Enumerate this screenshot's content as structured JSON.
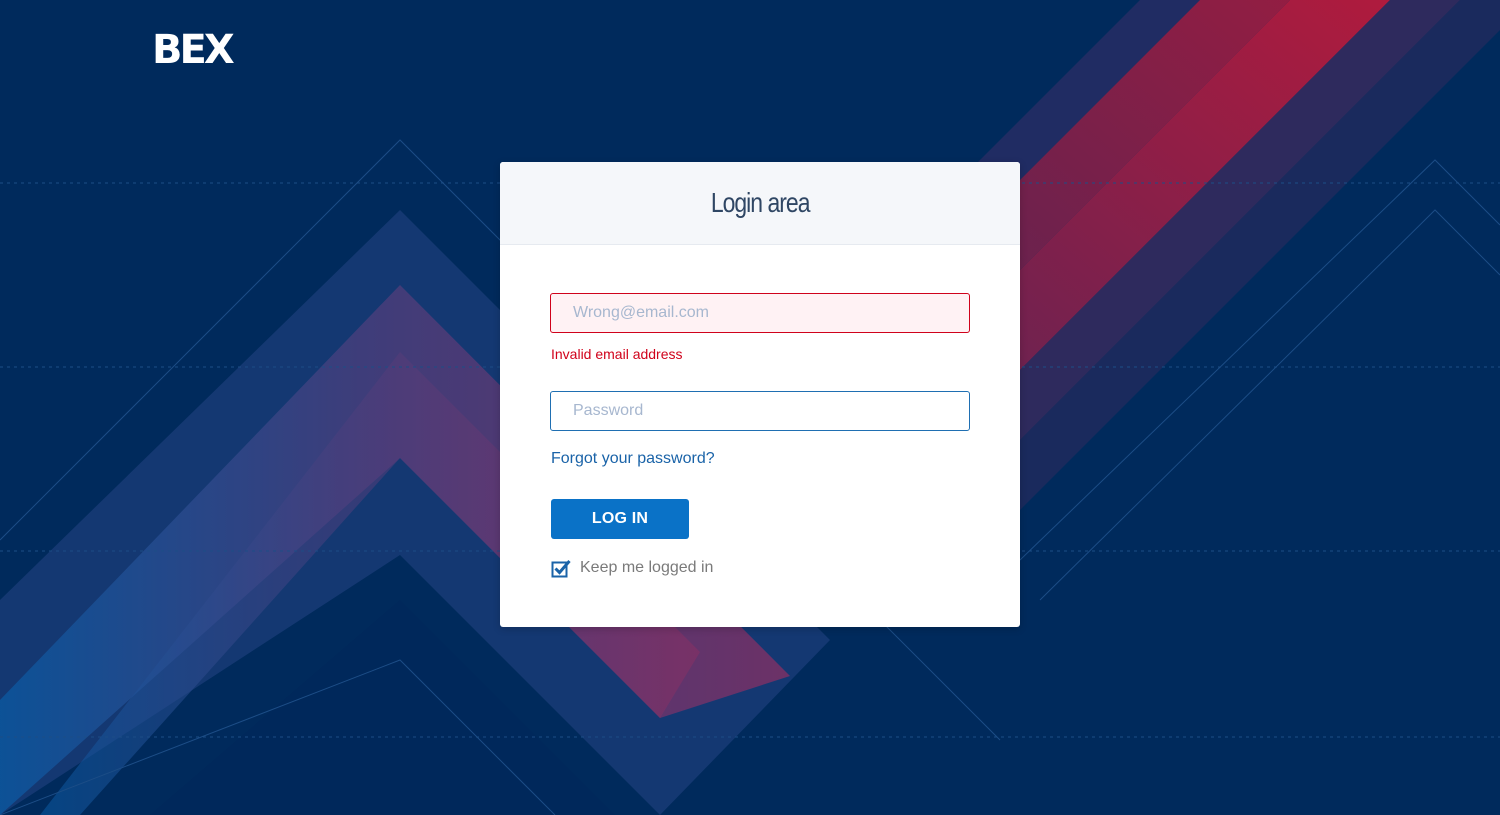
{
  "brand": {
    "logo_text": "BEX"
  },
  "login_card": {
    "title": "Login area",
    "email": {
      "value": "",
      "placeholder": "Wrong@email.com",
      "error": "Invalid email address"
    },
    "password": {
      "value": "",
      "placeholder": "Password"
    },
    "forgot_link": "Forgot your password?",
    "login_button": "LOG IN",
    "keep_logged_in": {
      "label": "Keep me logged in",
      "checked": true
    }
  },
  "colors": {
    "background": "#002a5c",
    "accent": "#0a72c7",
    "error": "#d0021b",
    "stripe_red": "#c0183a"
  }
}
